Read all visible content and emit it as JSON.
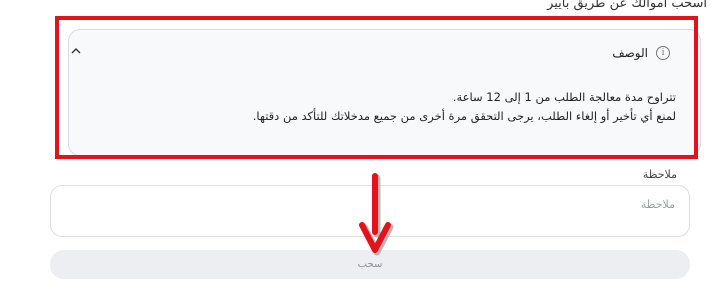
{
  "page": {
    "section_title": "اسحب أموالك عن طريق بايير"
  },
  "description": {
    "title": "الوصف",
    "info_icon": "info-icon",
    "toggle_icon": "chevron-up-icon",
    "line1": "تتراوح مدة معالجة الطلب من 1 إلى 12 ساعة.",
    "line2": "لمنع أي تأخير أو إلغاء الطلب، يرجى التحقق مرة أخرى من جميع مدخلاتك للتأكد من دقتها."
  },
  "note": {
    "label": "ملاحظة",
    "placeholder": "ملاحظة",
    "value": ""
  },
  "actions": {
    "withdraw_label": "سحب"
  },
  "colors": {
    "highlight": "#e3121b",
    "card_bg": "#f8f9fb",
    "button_bg": "#eceef1"
  }
}
